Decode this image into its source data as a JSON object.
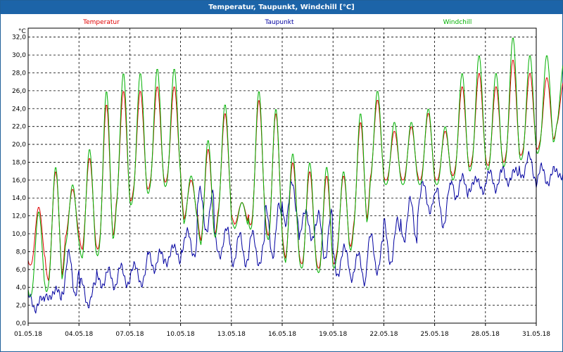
{
  "window": {
    "title": "Temperatur, Taupunkt, Windchill [°C]"
  },
  "colors": {
    "temperatur": "#e00000",
    "taupunkt": "#0000a0",
    "windchill": "#00b000",
    "grid": "#000000",
    "titlebar": "#1c64a8"
  },
  "chart_data": {
    "type": "line",
    "title": "Temperatur, Taupunkt, Windchill [°C]",
    "unit_label": "°C",
    "ylim": [
      0,
      33
    ],
    "y_ticks": [
      "0,0",
      "2,0",
      "4,0",
      "6,0",
      "8,0",
      "10,0",
      "12,0",
      "14,0",
      "16,0",
      "18,0",
      "20,0",
      "22,0",
      "24,0",
      "26,0",
      "28,0",
      "30,0",
      "32,0"
    ],
    "x_ticks": [
      "01.05.18",
      "04.05.18",
      "07.05.18",
      "10.05.18",
      "13.05.18",
      "16.05.18",
      "19.05.18",
      "22.05.18",
      "25.05.18",
      "28.05.18",
      "31.05.18"
    ],
    "xlim": [
      "01.05.18 00:00",
      "01.06.18 23:00"
    ],
    "grid": true,
    "legend_placement": "top",
    "series": [
      {
        "name": "Temperatur",
        "color": "#e00000",
        "days": [
          {
            "min": 6.5,
            "max": 13.0
          },
          {
            "min": 4.5,
            "max": 17.0
          },
          {
            "min": 9.5,
            "max": 15.0
          },
          {
            "min": 8.0,
            "max": 18.5
          },
          {
            "min": 8.5,
            "max": 24.5
          },
          {
            "min": 13.0,
            "max": 26.0
          },
          {
            "min": 14.5,
            "max": 26.0
          },
          {
            "min": 15.5,
            "max": 26.5
          },
          {
            "min": 16.0,
            "max": 26.5
          },
          {
            "min": 11.5,
            "max": 16.0
          },
          {
            "min": 9.0,
            "max": 19.5
          },
          {
            "min": 12.0,
            "max": 23.5
          },
          {
            "min": 11.0,
            "max": 13.5
          },
          {
            "min": 11.0,
            "max": 25.0
          },
          {
            "min": 9.5,
            "max": 23.5
          },
          {
            "min": 7.0,
            "max": 18.0
          },
          {
            "min": 6.5,
            "max": 17.0
          },
          {
            "min": 6.0,
            "max": 16.5
          },
          {
            "min": 7.5,
            "max": 16.5
          },
          {
            "min": 10.5,
            "max": 22.5
          },
          {
            "min": 16.0,
            "max": 25.0
          },
          {
            "min": 16.0,
            "max": 21.5
          },
          {
            "min": 16.0,
            "max": 22.0
          },
          {
            "min": 16.0,
            "max": 23.5
          },
          {
            "min": 16.0,
            "max": 21.5
          },
          {
            "min": 17.0,
            "max": 26.5
          },
          {
            "min": 18.0,
            "max": 28.0
          },
          {
            "min": 17.5,
            "max": 26.5
          },
          {
            "min": 18.5,
            "max": 29.5
          },
          {
            "min": 19.0,
            "max": 28.0
          },
          {
            "min": 20.0,
            "max": 27.5
          },
          {
            "min": 22.0,
            "max": 27.0
          }
        ]
      },
      {
        "name": "Taupunkt",
        "color": "#0000a0",
        "days": [
          {
            "min": 1.5,
            "max": 3.0
          },
          {
            "min": 2.5,
            "max": 4.0
          },
          {
            "min": 3.0,
            "max": 8.0
          },
          {
            "min": 1.5,
            "max": 5.0
          },
          {
            "min": 4.0,
            "max": 6.0
          },
          {
            "min": 4.0,
            "max": 6.5
          },
          {
            "min": 4.0,
            "max": 7.0
          },
          {
            "min": 6.0,
            "max": 8.0
          },
          {
            "min": 6.5,
            "max": 9.0
          },
          {
            "min": 7.5,
            "max": 10.5
          },
          {
            "min": 10.0,
            "max": 15.0
          },
          {
            "min": 7.0,
            "max": 11.0
          },
          {
            "min": 6.5,
            "max": 10.0
          },
          {
            "min": 6.0,
            "max": 10.5
          },
          {
            "min": 7.0,
            "max": 13.5
          },
          {
            "min": 11.0,
            "max": 16.0
          },
          {
            "min": 9.0,
            "max": 13.0
          },
          {
            "min": 7.0,
            "max": 12.5
          },
          {
            "min": 5.0,
            "max": 9.0
          },
          {
            "min": 4.5,
            "max": 8.0
          },
          {
            "min": 5.5,
            "max": 10.0
          },
          {
            "min": 6.0,
            "max": 12.0
          },
          {
            "min": 9.0,
            "max": 14.0
          },
          {
            "min": 12.0,
            "max": 16.0
          },
          {
            "min": 10.5,
            "max": 15.5
          },
          {
            "min": 14.0,
            "max": 16.5
          },
          {
            "min": 14.5,
            "max": 16.5
          },
          {
            "min": 15.0,
            "max": 17.0
          },
          {
            "min": 15.5,
            "max": 17.5
          },
          {
            "min": 16.0,
            "max": 19.0
          },
          {
            "min": 15.5,
            "max": 17.5
          },
          {
            "min": 16.0,
            "max": 17.5
          }
        ]
      },
      {
        "name": "Windchill",
        "color": "#00b000",
        "days": [
          {
            "min": 3.0,
            "max": 12.5
          },
          {
            "min": 4.0,
            "max": 17.5
          },
          {
            "min": 8.5,
            "max": 15.5
          },
          {
            "min": 7.0,
            "max": 19.5
          },
          {
            "min": 8.0,
            "max": 26.0
          },
          {
            "min": 12.5,
            "max": 28.0
          },
          {
            "min": 14.0,
            "max": 28.0
          },
          {
            "min": 15.0,
            "max": 28.5
          },
          {
            "min": 15.5,
            "max": 28.5
          },
          {
            "min": 11.0,
            "max": 16.5
          },
          {
            "min": 8.5,
            "max": 20.5
          },
          {
            "min": 11.5,
            "max": 24.5
          },
          {
            "min": 10.5,
            "max": 13.5
          },
          {
            "min": 10.5,
            "max": 26.0
          },
          {
            "min": 9.0,
            "max": 24.0
          },
          {
            "min": 6.5,
            "max": 19.0
          },
          {
            "min": 6.0,
            "max": 18.0
          },
          {
            "min": 5.5,
            "max": 17.5
          },
          {
            "min": 7.0,
            "max": 17.0
          },
          {
            "min": 10.0,
            "max": 23.5
          },
          {
            "min": 15.5,
            "max": 26.0
          },
          {
            "min": 15.5,
            "max": 22.5
          },
          {
            "min": 15.5,
            "max": 22.5
          },
          {
            "min": 15.5,
            "max": 24.0
          },
          {
            "min": 15.5,
            "max": 22.0
          },
          {
            "min": 16.5,
            "max": 28.0
          },
          {
            "min": 17.5,
            "max": 30.0
          },
          {
            "min": 17.0,
            "max": 28.0
          },
          {
            "min": 18.0,
            "max": 32.0
          },
          {
            "min": 18.5,
            "max": 30.0
          },
          {
            "min": 19.5,
            "max": 30.0
          },
          {
            "min": 22.0,
            "max": 29.0
          }
        ]
      }
    ]
  }
}
